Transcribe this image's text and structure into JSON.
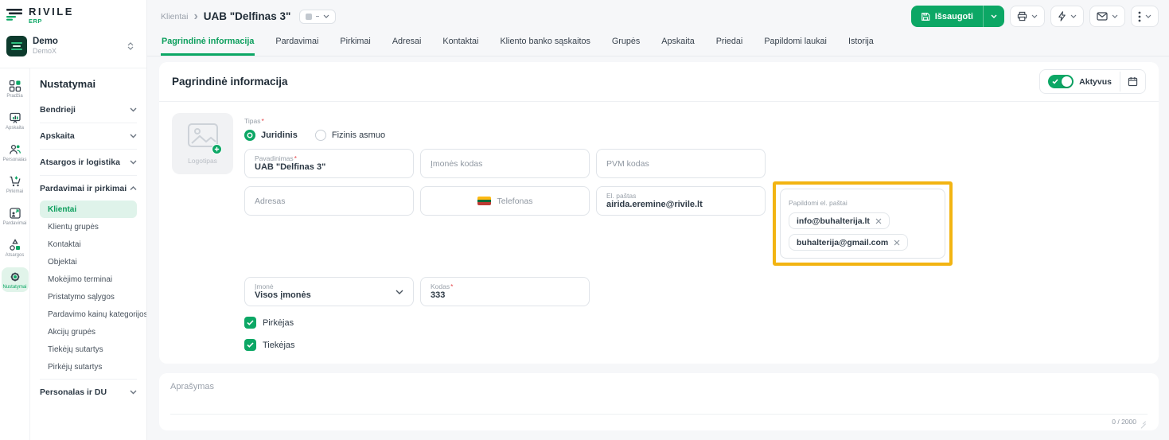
{
  "brand": {
    "name": "RIVILE",
    "product": "ERP"
  },
  "org": {
    "name": "Demo",
    "subtitle": "DemoX"
  },
  "rail": {
    "items": [
      "Pradžia",
      "Apskaita",
      "Personalas",
      "Pirkimai",
      "Pardavimai",
      "Atsargos",
      "Nustatymai"
    ],
    "active": "Nustatymai"
  },
  "nav": {
    "title": "Nustatymai",
    "sections": [
      "Bendrieji",
      "Apskaita",
      "Atsargos ir logistika",
      "Pardavimai ir pirkimai",
      "Personalas ir DU"
    ],
    "expanded_section": "Pardavimai ir pirkimai",
    "items": [
      "Klientai",
      "Klientų grupės",
      "Kontaktai",
      "Objektai",
      "Mokėjimo terminai",
      "Pristatymo sąlygos",
      "Pardavimo kainų kategorijos",
      "Akcijų grupės",
      "Tiekėjų sutartys",
      "Pirkėjų sutartys"
    ],
    "active_item": "Klientai"
  },
  "breadcrumb": {
    "parent": "Klientai",
    "current": "UAB \"Delfinas 3\""
  },
  "actions": {
    "save_label": "Išsaugoti"
  },
  "tabs": {
    "active": "Pagrindinė informacija",
    "items": [
      "Pagrindinė informacija",
      "Pardavimai",
      "Pirkimai",
      "Adresai",
      "Kontaktai",
      "Kliento banko sąskaitos",
      "Grupės",
      "Apskaita",
      "Priedai",
      "Papildomi laukai",
      "Istorija"
    ]
  },
  "panel": {
    "title": "Pagrindinė informacija",
    "active_label": "Aktyvus",
    "active_on": true
  },
  "form": {
    "logo_label": "Logotipas",
    "tipas": {
      "label": "Tipas",
      "options": [
        "Juridinis",
        "Fizinis asmuo"
      ],
      "selected": "Juridinis"
    },
    "fields": {
      "pavadinimas": {
        "label": "Pavadinimas",
        "value": "UAB \"Delfinas 3\""
      },
      "imones_kodas": {
        "placeholder": "Įmonės kodas"
      },
      "pvm_kodas": {
        "placeholder": "PVM kodas"
      },
      "adresas": {
        "placeholder": "Adresas"
      },
      "telefonas": {
        "placeholder": "Telefonas"
      },
      "el_pastas": {
        "label": "El. paštas",
        "value": "airida.eremine@rivile.lt"
      },
      "papildomi": {
        "label": "Papildomi el. paštai",
        "chips": [
          "info@buhalterija.lt",
          "buhalterija@gmail.com"
        ]
      },
      "imone": {
        "label": "Įmonė",
        "value": "Visos įmonės"
      },
      "kodas": {
        "label": "Kodas",
        "value": "333"
      }
    },
    "checkboxes": [
      "Pirkėjas",
      "Tiekėjas"
    ]
  },
  "description": {
    "placeholder": "Aprašymas",
    "counter": "0 / 2000"
  },
  "ui": {
    "required_mark": "*",
    "crumb_separator": "›"
  },
  "colors": {
    "accent": "#0CA765",
    "accent_bg": "#DFF3EA",
    "highlight": "#F2B412",
    "flag": [
      "#FDB913",
      "#046A38",
      "#BE3A34"
    ]
  }
}
